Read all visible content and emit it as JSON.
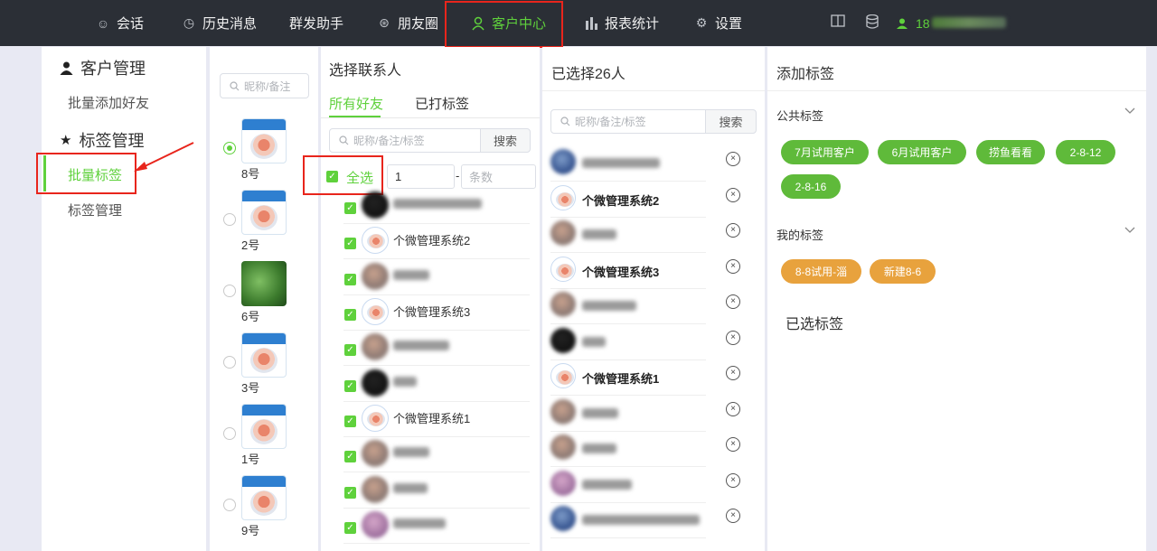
{
  "nav": {
    "items": [
      {
        "label": "会话",
        "icon": "chat-icon"
      },
      {
        "label": "历史消息",
        "icon": "clock-icon"
      },
      {
        "label": "群发助手",
        "icon": ""
      },
      {
        "label": "朋友圈",
        "icon": "aperture-icon"
      },
      {
        "label": "客户中心",
        "icon": "user-icon"
      },
      {
        "label": "报表统计",
        "icon": "bar-chart-icon"
      },
      {
        "label": "设置",
        "icon": "gear-icon"
      }
    ],
    "active": "客户中心",
    "user_prefix": "18"
  },
  "sidebar": {
    "customer_heading": "客户管理",
    "customer_items": [
      "批量添加好友"
    ],
    "tag_heading": "标签管理",
    "tag_items": [
      "批量标签",
      "标签管理"
    ],
    "active_item": "批量标签"
  },
  "accounts": {
    "search_placeholder": "昵称/备注",
    "items": [
      {
        "name": "8号",
        "selected": true,
        "avatar": "app"
      },
      {
        "name": "2号",
        "selected": false,
        "avatar": "app"
      },
      {
        "name": "6号",
        "selected": false,
        "avatar": "leaf"
      },
      {
        "name": "3号",
        "selected": false,
        "avatar": "app"
      },
      {
        "name": "1号",
        "selected": false,
        "avatar": "app"
      },
      {
        "name": "9号",
        "selected": false,
        "avatar": "app"
      }
    ]
  },
  "contacts": {
    "title": "选择联系人",
    "tabs": [
      "所有好友",
      "已打标签"
    ],
    "search_placeholder": "昵称/备注/标签",
    "search_button": "搜索",
    "select_all_label": "全选",
    "range_start": "1",
    "range_separator": "-",
    "range_end_placeholder": "条数",
    "rows": [
      {
        "name": "",
        "avatar": "dark",
        "checked": true
      },
      {
        "name": "个微管理系统2",
        "avatar": "app",
        "checked": true
      },
      {
        "name": "",
        "avatar": "blur",
        "checked": true
      },
      {
        "name": "个微管理系统3",
        "avatar": "app",
        "checked": true
      },
      {
        "name": "",
        "avatar": "blur",
        "checked": true
      },
      {
        "name": "",
        "avatar": "dark",
        "checked": true
      },
      {
        "name": "个微管理系统1",
        "avatar": "app",
        "checked": true
      },
      {
        "name": "",
        "avatar": "blur",
        "checked": true
      },
      {
        "name": "",
        "avatar": "blur",
        "checked": true
      },
      {
        "name": "",
        "avatar": "pink",
        "checked": true
      }
    ]
  },
  "selected": {
    "title": "已选择26人",
    "search_placeholder": "昵称/备注/标签",
    "search_button": "搜索",
    "remove_symbol": "×",
    "rows": [
      {
        "name": "",
        "avatar": "blue"
      },
      {
        "name": "个微管理系统2",
        "avatar": "app"
      },
      {
        "name": "",
        "avatar": "blur"
      },
      {
        "name": "个微管理系统3",
        "avatar": "app"
      },
      {
        "name": "",
        "avatar": "blur"
      },
      {
        "name": "",
        "avatar": "dark"
      },
      {
        "name": "个微管理系统1",
        "avatar": "app"
      },
      {
        "name": "",
        "avatar": "blur"
      },
      {
        "name": "",
        "avatar": "blur"
      },
      {
        "name": "",
        "avatar": "pink"
      },
      {
        "name": "",
        "avatar": "blue"
      }
    ]
  },
  "tags": {
    "title": "添加标签",
    "public_title": "公共标签",
    "public_tags": [
      "7月试用客户",
      "6月试用客户",
      "捞鱼看看",
      "2-8-12",
      "2-8-16"
    ],
    "mine_title": "我的标签",
    "my_tags": [
      "8-8试用-淄",
      "新建8-6"
    ],
    "chosen_title": "已选标签"
  },
  "colors": {
    "accent": "#5fd13c",
    "topbar": "#2b2f36",
    "highlight": "#e8251c",
    "tag_green": "#5fba3a",
    "tag_orange": "#e8a23d"
  }
}
